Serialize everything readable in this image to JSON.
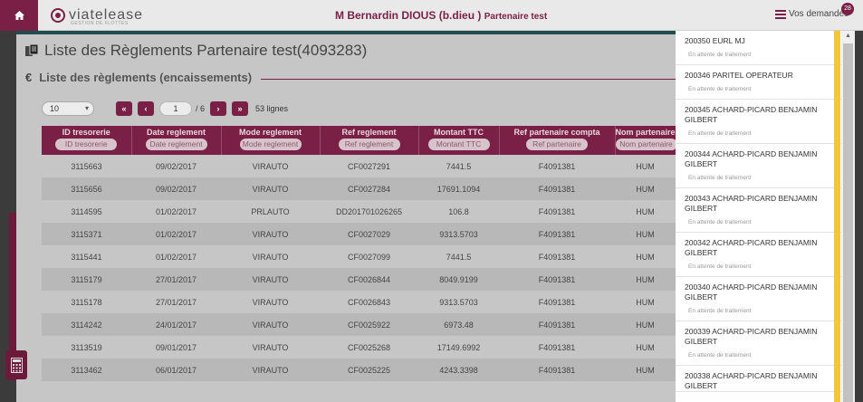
{
  "topbar": {
    "logo_text": "viatelease",
    "logo_sub": "GESTION DE FLOTTES",
    "user_name": "M Bernardin DIOUS",
    "user_login": "(b.dieu )",
    "partner": "Partenaire test",
    "requests_label": "Vos demandes",
    "requests_count": "28"
  },
  "page": {
    "title": "Liste des Règlements Partenaire test(4093283)",
    "section_icon": "€",
    "section_title": "Liste des règlements (encaissements)"
  },
  "pager": {
    "page_size": "10",
    "current_page": "1",
    "total_pages": "/ 6",
    "row_count": "53 lignes"
  },
  "table": {
    "columns": [
      {
        "label": "ID tresorerie",
        "filter": "ID tresorerie"
      },
      {
        "label": "Date reglement",
        "filter": "Date reglement"
      },
      {
        "label": "Mode reglement",
        "filter": "Mode reglement"
      },
      {
        "label": "Ref reglement",
        "filter": "Ref reglement"
      },
      {
        "label": "Montant TTC",
        "filter": "Montant TTC"
      },
      {
        "label": "Ref partenaire compta",
        "filter": "Ref partenaire"
      },
      {
        "label": "Nom partenaire",
        "filter": "Nom partenaire"
      }
    ],
    "rows": [
      [
        "3115663",
        "09/02/2017",
        "VIRAUTO",
        "CF0027291",
        "7441.5",
        "F4091381",
        "HUM"
      ],
      [
        "3115656",
        "09/02/2017",
        "VIRAUTO",
        "CF0027284",
        "17691.1094",
        "F4091381",
        "HUM"
      ],
      [
        "3114595",
        "01/02/2017",
        "PRLAUTO",
        "DD201701026265",
        "106.8",
        "F4091381",
        "HUM"
      ],
      [
        "3115371",
        "01/02/2017",
        "VIRAUTO",
        "CF0027029",
        "9313.5703",
        "F4091381",
        "HUM"
      ],
      [
        "3115441",
        "01/02/2017",
        "VIRAUTO",
        "CF0027099",
        "7441.5",
        "F4091381",
        "HUM"
      ],
      [
        "3115179",
        "27/01/2017",
        "VIRAUTO",
        "CF0026844",
        "8049.9199",
        "F4091381",
        "HUM"
      ],
      [
        "3115178",
        "27/01/2017",
        "VIRAUTO",
        "CF0026843",
        "9313.5703",
        "F4091381",
        "HUM"
      ],
      [
        "3114242",
        "24/01/2017",
        "VIRAUTO",
        "CF0025922",
        "6973.48",
        "F4091381",
        "HUM"
      ],
      [
        "3113519",
        "09/01/2017",
        "VIRAUTO",
        "CF0025268",
        "17149.6992",
        "F4091381",
        "HUM"
      ],
      [
        "3113462",
        "06/01/2017",
        "VIRAUTO",
        "CF0025225",
        "4243.3398",
        "F4091381",
        "HUM"
      ]
    ]
  },
  "requests": [
    {
      "title": "200350 EURL MJ",
      "status": "En attente de traitement"
    },
    {
      "title": "200346 PARITEL OPERATEUR",
      "status": "En attente de traitement"
    },
    {
      "title": "200345 ACHARD-PICARD BENJAMIN GILBERT",
      "status": "En attente de traitement"
    },
    {
      "title": "200344 ACHARD-PICARD BENJAMIN GILBERT",
      "status": "En attente de traitement"
    },
    {
      "title": "200343 ACHARD-PICARD BENJAMIN GILBERT",
      "status": "En attente de traitement"
    },
    {
      "title": "200342 ACHARD-PICARD BENJAMIN GILBERT",
      "status": "En attente de traitement"
    },
    {
      "title": "200340 ACHARD-PICARD BENJAMIN GILBERT",
      "status": "En attente de traitement"
    },
    {
      "title": "200339 ACHARD-PICARD BENJAMIN GILBERT",
      "status": "En attente de traitement"
    },
    {
      "title": "200338 ACHARD-PICARD BENJAMIN GILBERT",
      "status": ""
    }
  ],
  "colors": {
    "brand": "#7a1f45",
    "scroll_highlight": "#f3c73b"
  }
}
